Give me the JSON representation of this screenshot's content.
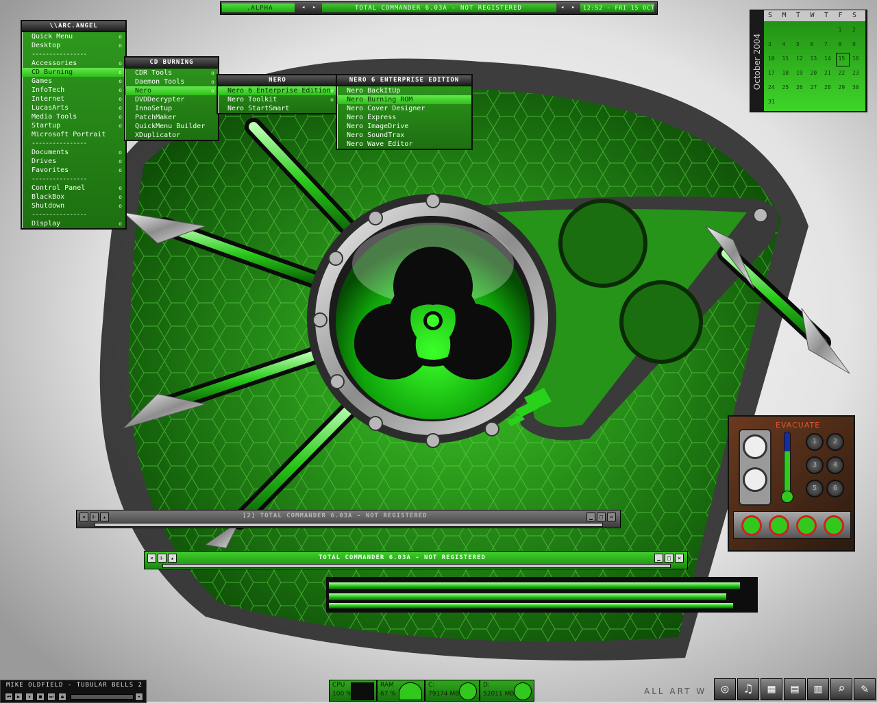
{
  "top_bar": {
    "workspace": ".ALPHA",
    "window_title": "TOTAL COMMANDER 6.03A - NOT REGISTERED",
    "clock": "12:52 - FRI 15 OCT"
  },
  "main_menu": {
    "title": "\\\\ARC.ANGEL",
    "items": [
      {
        "label": "Quick Menu",
        "submenu": true
      },
      {
        "label": "Desktop",
        "submenu": true
      },
      {
        "sep": true
      },
      {
        "label": "Accessories",
        "submenu": true
      },
      {
        "label": "CD Burning",
        "submenu": true,
        "selected": true
      },
      {
        "label": "Games",
        "submenu": true
      },
      {
        "label": "InfoTech",
        "submenu": true
      },
      {
        "label": "Internet",
        "submenu": true
      },
      {
        "label": "LucasArts",
        "submenu": true
      },
      {
        "label": "Media Tools",
        "submenu": true
      },
      {
        "label": "Startup",
        "submenu": true
      },
      {
        "label": "Microsoft Portrait",
        "submenu": false
      },
      {
        "sep": true
      },
      {
        "label": "Documents",
        "submenu": true
      },
      {
        "label": "Drives",
        "submenu": true
      },
      {
        "label": "Favorites",
        "submenu": true
      },
      {
        "sep": true
      },
      {
        "label": "Control Panel",
        "submenu": true
      },
      {
        "label": "BlackBox",
        "submenu": true
      },
      {
        "label": "Shutdown",
        "submenu": true
      },
      {
        "sep": true
      },
      {
        "label": "Display",
        "submenu": true
      }
    ]
  },
  "cd_menu": {
    "title": "CD BURNING",
    "items": [
      {
        "label": "CDR Tools",
        "submenu": true
      },
      {
        "label": "Daemon Tools",
        "submenu": true
      },
      {
        "label": "Nero",
        "submenu": true,
        "selected": true
      },
      {
        "label": "DVDDecrypter",
        "submenu": false
      },
      {
        "label": "InnoSetup",
        "submenu": false
      },
      {
        "label": "PatchMaker",
        "submenu": false
      },
      {
        "label": "QuickMenu Builder",
        "submenu": false
      },
      {
        "label": "XDuplicator",
        "submenu": false
      }
    ]
  },
  "nero_menu": {
    "title": "NERO",
    "items": [
      {
        "label": "Nero 6 Enterprise Edition",
        "submenu": true,
        "selected": true
      },
      {
        "label": "Nero Toolkit",
        "submenu": true
      },
      {
        "label": "Nero StartSmart",
        "submenu": false
      }
    ]
  },
  "nero_ee_menu": {
    "title": "NERO 6 ENTERPRISE EDITION",
    "items": [
      {
        "label": "Nero BackItUp",
        "submenu": false
      },
      {
        "label": "Nero Burning ROM",
        "submenu": false,
        "selected": true
      },
      {
        "label": "Nero Cover Designer",
        "submenu": false
      },
      {
        "label": "Nero Express",
        "submenu": false
      },
      {
        "label": "Nero ImageDrive",
        "submenu": false
      },
      {
        "label": "Nero SoundTrax",
        "submenu": false
      },
      {
        "label": "Nero Wave Editor",
        "submenu": false
      }
    ]
  },
  "calendar": {
    "month_label": "October 2004",
    "weekdays": [
      "S",
      "M",
      "T",
      "W",
      "T",
      "F",
      "S"
    ],
    "first_weekday": 5,
    "days": 31,
    "today": 15
  },
  "tc_inactive": {
    "title": "[2] TOTAL COMMANDER 6.03A - NOT REGISTERED"
  },
  "tc_active": {
    "title": "TOTAL COMMANDER 6.03A - NOT REGISTERED"
  },
  "widget": {
    "label": "EVACUATE",
    "buttons": [
      "1",
      "2",
      "3",
      "4",
      "5",
      "6"
    ]
  },
  "media_player": {
    "track": "MIKE OLDFIELD - TUBULAR BELLS 2"
  },
  "monitors": [
    {
      "label": "CPU",
      "value": "100 %"
    },
    {
      "label": "RAM",
      "value": "67 %"
    },
    {
      "label": "C:",
      "value": "79174 MB"
    },
    {
      "label": "D:",
      "value": "52011 MB"
    }
  ],
  "credit": "ALL ART W",
  "colors": {
    "accent": "#33d11e",
    "dark": "#1a1a1a",
    "bg": "#d8d8d8"
  },
  "tray_icons": [
    "cd-icon",
    "media-icon",
    "server-icon",
    "books-icon",
    "book-icon",
    "search-icon",
    "tools-icon"
  ]
}
